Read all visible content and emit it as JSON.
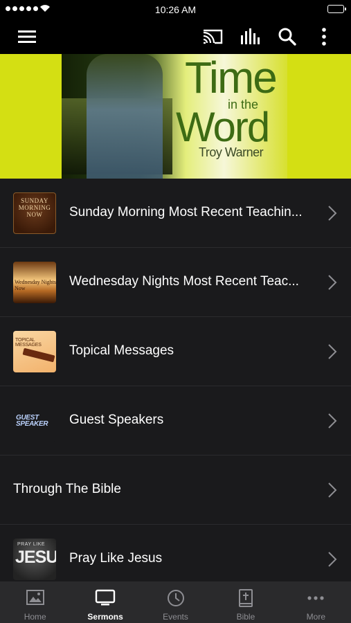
{
  "status_bar": {
    "time": "10:26 AM"
  },
  "banner": {
    "title_line1": "Time",
    "title_line2": "in the",
    "title_line3": "Word",
    "author": "Troy Warner"
  },
  "list": [
    {
      "label": "Sunday Morning Most Recent Teachin...",
      "thumb_text": "SUNDAY MORNING NOW"
    },
    {
      "label": "Wednesday Nights Most Recent Teac...",
      "thumb_text": "Wednesday Nights Now"
    },
    {
      "label": "Topical Messages",
      "thumb_text": "TOPICAL MESSAGES"
    },
    {
      "label": "Guest Speakers",
      "thumb_text": "GUEST SPEAKER"
    },
    {
      "label": "Through The Bible"
    },
    {
      "label": "Pray Like Jesus",
      "thumb_text_top": "PRAY LIKE",
      "thumb_text_main": "JESUS"
    }
  ],
  "tabs": [
    {
      "label": "Home",
      "icon": "image-icon"
    },
    {
      "label": "Sermons",
      "icon": "tv-icon",
      "active": true
    },
    {
      "label": "Events",
      "icon": "clock-icon"
    },
    {
      "label": "Bible",
      "icon": "bible-icon"
    },
    {
      "label": "More",
      "icon": "ellipsis-icon"
    }
  ],
  "colors": {
    "banner_accent": "#d4df13",
    "background": "#1a1a1c",
    "tab_active": "#ffffff",
    "tab_inactive": "#8e8e93"
  }
}
